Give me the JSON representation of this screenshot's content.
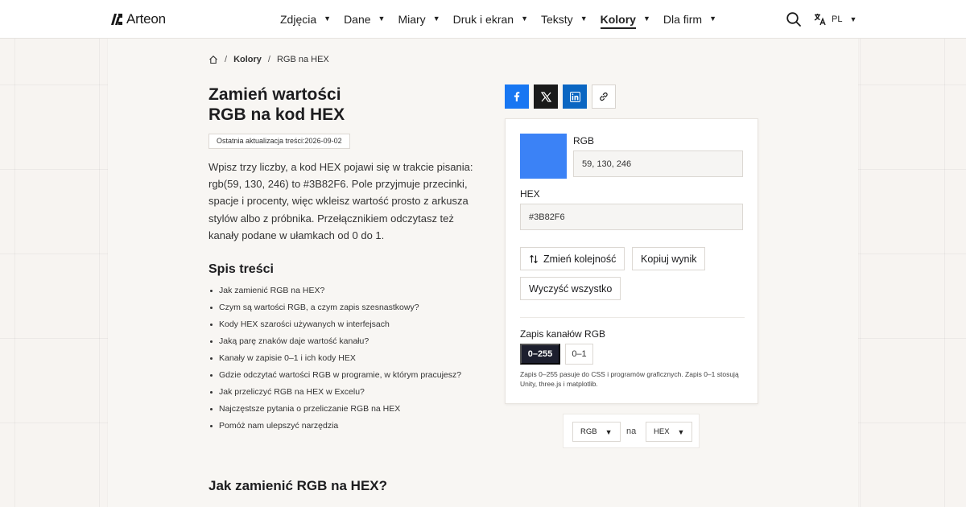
{
  "header": {
    "logo_text": "Arteon",
    "nav": [
      {
        "label": "Zdjęcia"
      },
      {
        "label": "Dane"
      },
      {
        "label": "Miary"
      },
      {
        "label": "Druk i ekran"
      },
      {
        "label": "Teksty"
      },
      {
        "label": "Kolory",
        "active": true
      },
      {
        "label": "Dla firm"
      }
    ],
    "lang": "PL"
  },
  "breadcrumb": {
    "section": "Kolory",
    "current": "RGB na HEX"
  },
  "article": {
    "title_line1": "Zamień wartości",
    "title_line2": "RGB na kod HEX",
    "updated_label": "Ostatnia aktualizacja treści:",
    "updated_date": "2026-09-02",
    "intro": "Wpisz trzy liczby, a kod HEX pojawi się w trakcie pisania: rgb(59, 130, 246) to #3B82F6. Pole przyjmuje przecinki, spacje i procenty, więc wkleisz wartość prosto z arkusza stylów albo z próbnika. Przełącznikiem odczytasz też kanały podane w ułamkach od 0 do 1.",
    "toc_heading": "Spis treści",
    "toc": [
      "Jak zamienić RGB na HEX?",
      "Czym są wartości RGB, a czym zapis szesnastkowy?",
      "Kody HEX szarości używanych w interfejsach",
      "Jaką parę znaków daje wartość kanału?",
      "Kanały w zapisie 0–1 i ich kody HEX",
      "Gdzie odczytać wartości RGB w programie, w którym pracujesz?",
      "Jak przeliczyć RGB na HEX w Excelu?",
      "Najczęstsze pytania o przeliczanie RGB na HEX",
      "Pomóż nam ulepszyć narzędzia"
    ],
    "section_heading": "Jak zamienić RGB na HEX?"
  },
  "share": {
    "icons": [
      "facebook-icon",
      "x-icon",
      "linkedin-icon",
      "link-icon"
    ]
  },
  "converter": {
    "swatch_color": "#3B82F6",
    "rgb_label": "RGB",
    "rgb_value": "59, 130, 246",
    "hex_label": "HEX",
    "hex_value": "#3B82F6",
    "swap_label": "Zmień kolejność",
    "copy_label": "Kopiuj wynik",
    "clear_label": "Wyczyść wszystko",
    "mode_label": "Zapis kanałów RGB",
    "mode_on": "0–255",
    "mode_off": "0–1",
    "hint": "Zapis 0–255 pasuje do CSS i programów graficznych. Zapis 0–1 stosują Unity, three.js i matplotlib."
  },
  "format": {
    "from": "RGB",
    "joiner": "na",
    "to": "HEX"
  },
  "colors": {
    "facebook": "#1877f2",
    "x": "#1a1a1a",
    "linkedin": "#0a66c2",
    "toggle_active": "#1d1f2e"
  }
}
